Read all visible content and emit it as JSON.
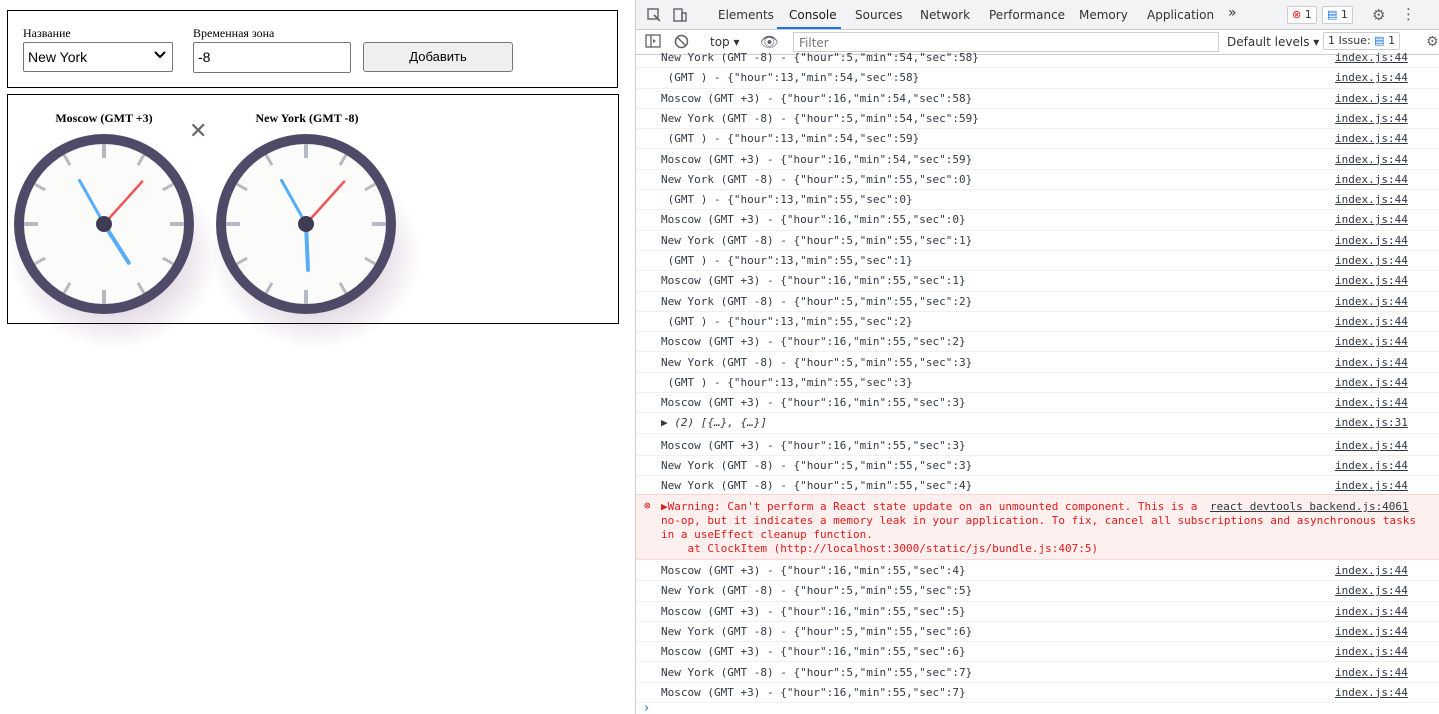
{
  "app": {
    "form": {
      "name_label": "Название",
      "tz_label": "Временная зона",
      "name_value": "New York",
      "tz_value": "-8",
      "add_label": "Добавить"
    },
    "clocks": [
      {
        "title": "Moscow (GMT +3)",
        "hour": 16,
        "min": 55,
        "sec": 7
      },
      {
        "title": "New York (GMT -8)",
        "hour": 5,
        "min": 55,
        "sec": 7
      }
    ],
    "delete_glyph": "✕"
  },
  "devtools": {
    "tabs": [
      "Elements",
      "Console",
      "Sources",
      "Network",
      "Performance",
      "Memory",
      "Application"
    ],
    "more_tabs": "»",
    "error_count": "1",
    "message_count": "1",
    "context": "top",
    "filter_placeholder": "Filter",
    "levels": "Default levels",
    "issues_label": "1 Issue:",
    "issues_count": "1",
    "rows": [
      {
        "msg": "New York (GMT -8) - {\"hour\":5,\"min\":54,\"sec\":58}",
        "src": "index.js:44"
      },
      {
        "msg": " (GMT ) - {\"hour\":13,\"min\":54,\"sec\":58}",
        "src": "index.js:44"
      },
      {
        "msg": "Moscow (GMT +3) - {\"hour\":16,\"min\":54,\"sec\":58}",
        "src": "index.js:44"
      },
      {
        "msg": "New York (GMT -8) - {\"hour\":5,\"min\":54,\"sec\":59}",
        "src": "index.js:44"
      },
      {
        "msg": " (GMT ) - {\"hour\":13,\"min\":54,\"sec\":59}",
        "src": "index.js:44"
      },
      {
        "msg": "Moscow (GMT +3) - {\"hour\":16,\"min\":54,\"sec\":59}",
        "src": "index.js:44"
      },
      {
        "msg": "New York (GMT -8) - {\"hour\":5,\"min\":55,\"sec\":0}",
        "src": "index.js:44"
      },
      {
        "msg": " (GMT ) - {\"hour\":13,\"min\":55,\"sec\":0}",
        "src": "index.js:44"
      },
      {
        "msg": "Moscow (GMT +3) - {\"hour\":16,\"min\":55,\"sec\":0}",
        "src": "index.js:44"
      },
      {
        "msg": "New York (GMT -8) - {\"hour\":5,\"min\":55,\"sec\":1}",
        "src": "index.js:44"
      },
      {
        "msg": " (GMT ) - {\"hour\":13,\"min\":55,\"sec\":1}",
        "src": "index.js:44"
      },
      {
        "msg": "Moscow (GMT +3) - {\"hour\":16,\"min\":55,\"sec\":1}",
        "src": "index.js:44"
      },
      {
        "msg": "New York (GMT -8) - {\"hour\":5,\"min\":55,\"sec\":2}",
        "src": "index.js:44"
      },
      {
        "msg": " (GMT ) - {\"hour\":13,\"min\":55,\"sec\":2}",
        "src": "index.js:44"
      },
      {
        "msg": "Moscow (GMT +3) - {\"hour\":16,\"min\":55,\"sec\":2}",
        "src": "index.js:44"
      },
      {
        "msg": "New York (GMT -8) - {\"hour\":5,\"min\":55,\"sec\":3}",
        "src": "index.js:44"
      },
      {
        "msg": " (GMT ) - {\"hour\":13,\"min\":55,\"sec\":3}",
        "src": "index.js:44"
      },
      {
        "msg": "Moscow (GMT +3) - {\"hour\":16,\"min\":55,\"sec\":3}",
        "src": "index.js:44"
      },
      {
        "msg": "▶ (2) [{…}, {…}]",
        "src": "index.js:31"
      },
      {
        "msg": "Moscow (GMT +3) - {\"hour\":16,\"min\":55,\"sec\":3}",
        "src": "index.js:44"
      },
      {
        "msg": "New York (GMT -8) - {\"hour\":5,\"min\":55,\"sec\":3}",
        "src": "index.js:44"
      },
      {
        "msg": "New York (GMT -8) - {\"hour\":5,\"min\":55,\"sec\":4}",
        "src": "index.js:44"
      }
    ],
    "warning": {
      "line1": "▶Warning: Can't perform a React state update on an unmounted component. This is a",
      "src": "react devtools backend.js:4061",
      "line2": "no-op, but it indicates a memory leak in your application. To fix, cancel all subscriptions and asynchronous tasks",
      "line3": "in a useEffect cleanup function.",
      "line4": "    at ClockItem (http://localhost:3000/static/js/bundle.js:407:5)"
    },
    "rows_after": [
      {
        "msg": "Moscow (GMT +3) - {\"hour\":16,\"min\":55,\"sec\":4}",
        "src": "index.js:44"
      },
      {
        "msg": "New York (GMT -8) - {\"hour\":5,\"min\":55,\"sec\":5}",
        "src": "index.js:44"
      },
      {
        "msg": "Moscow (GMT +3) - {\"hour\":16,\"min\":55,\"sec\":5}",
        "src": "index.js:44"
      },
      {
        "msg": "New York (GMT -8) - {\"hour\":5,\"min\":55,\"sec\":6}",
        "src": "index.js:44"
      },
      {
        "msg": "Moscow (GMT +3) - {\"hour\":16,\"min\":55,\"sec\":6}",
        "src": "index.js:44"
      },
      {
        "msg": "New York (GMT -8) - {\"hour\":5,\"min\":55,\"sec\":7}",
        "src": "index.js:44"
      },
      {
        "msg": "Moscow (GMT +3) - {\"hour\":16,\"min\":55,\"sec\":7}",
        "src": "index.js:44"
      }
    ],
    "prompt": "›"
  }
}
